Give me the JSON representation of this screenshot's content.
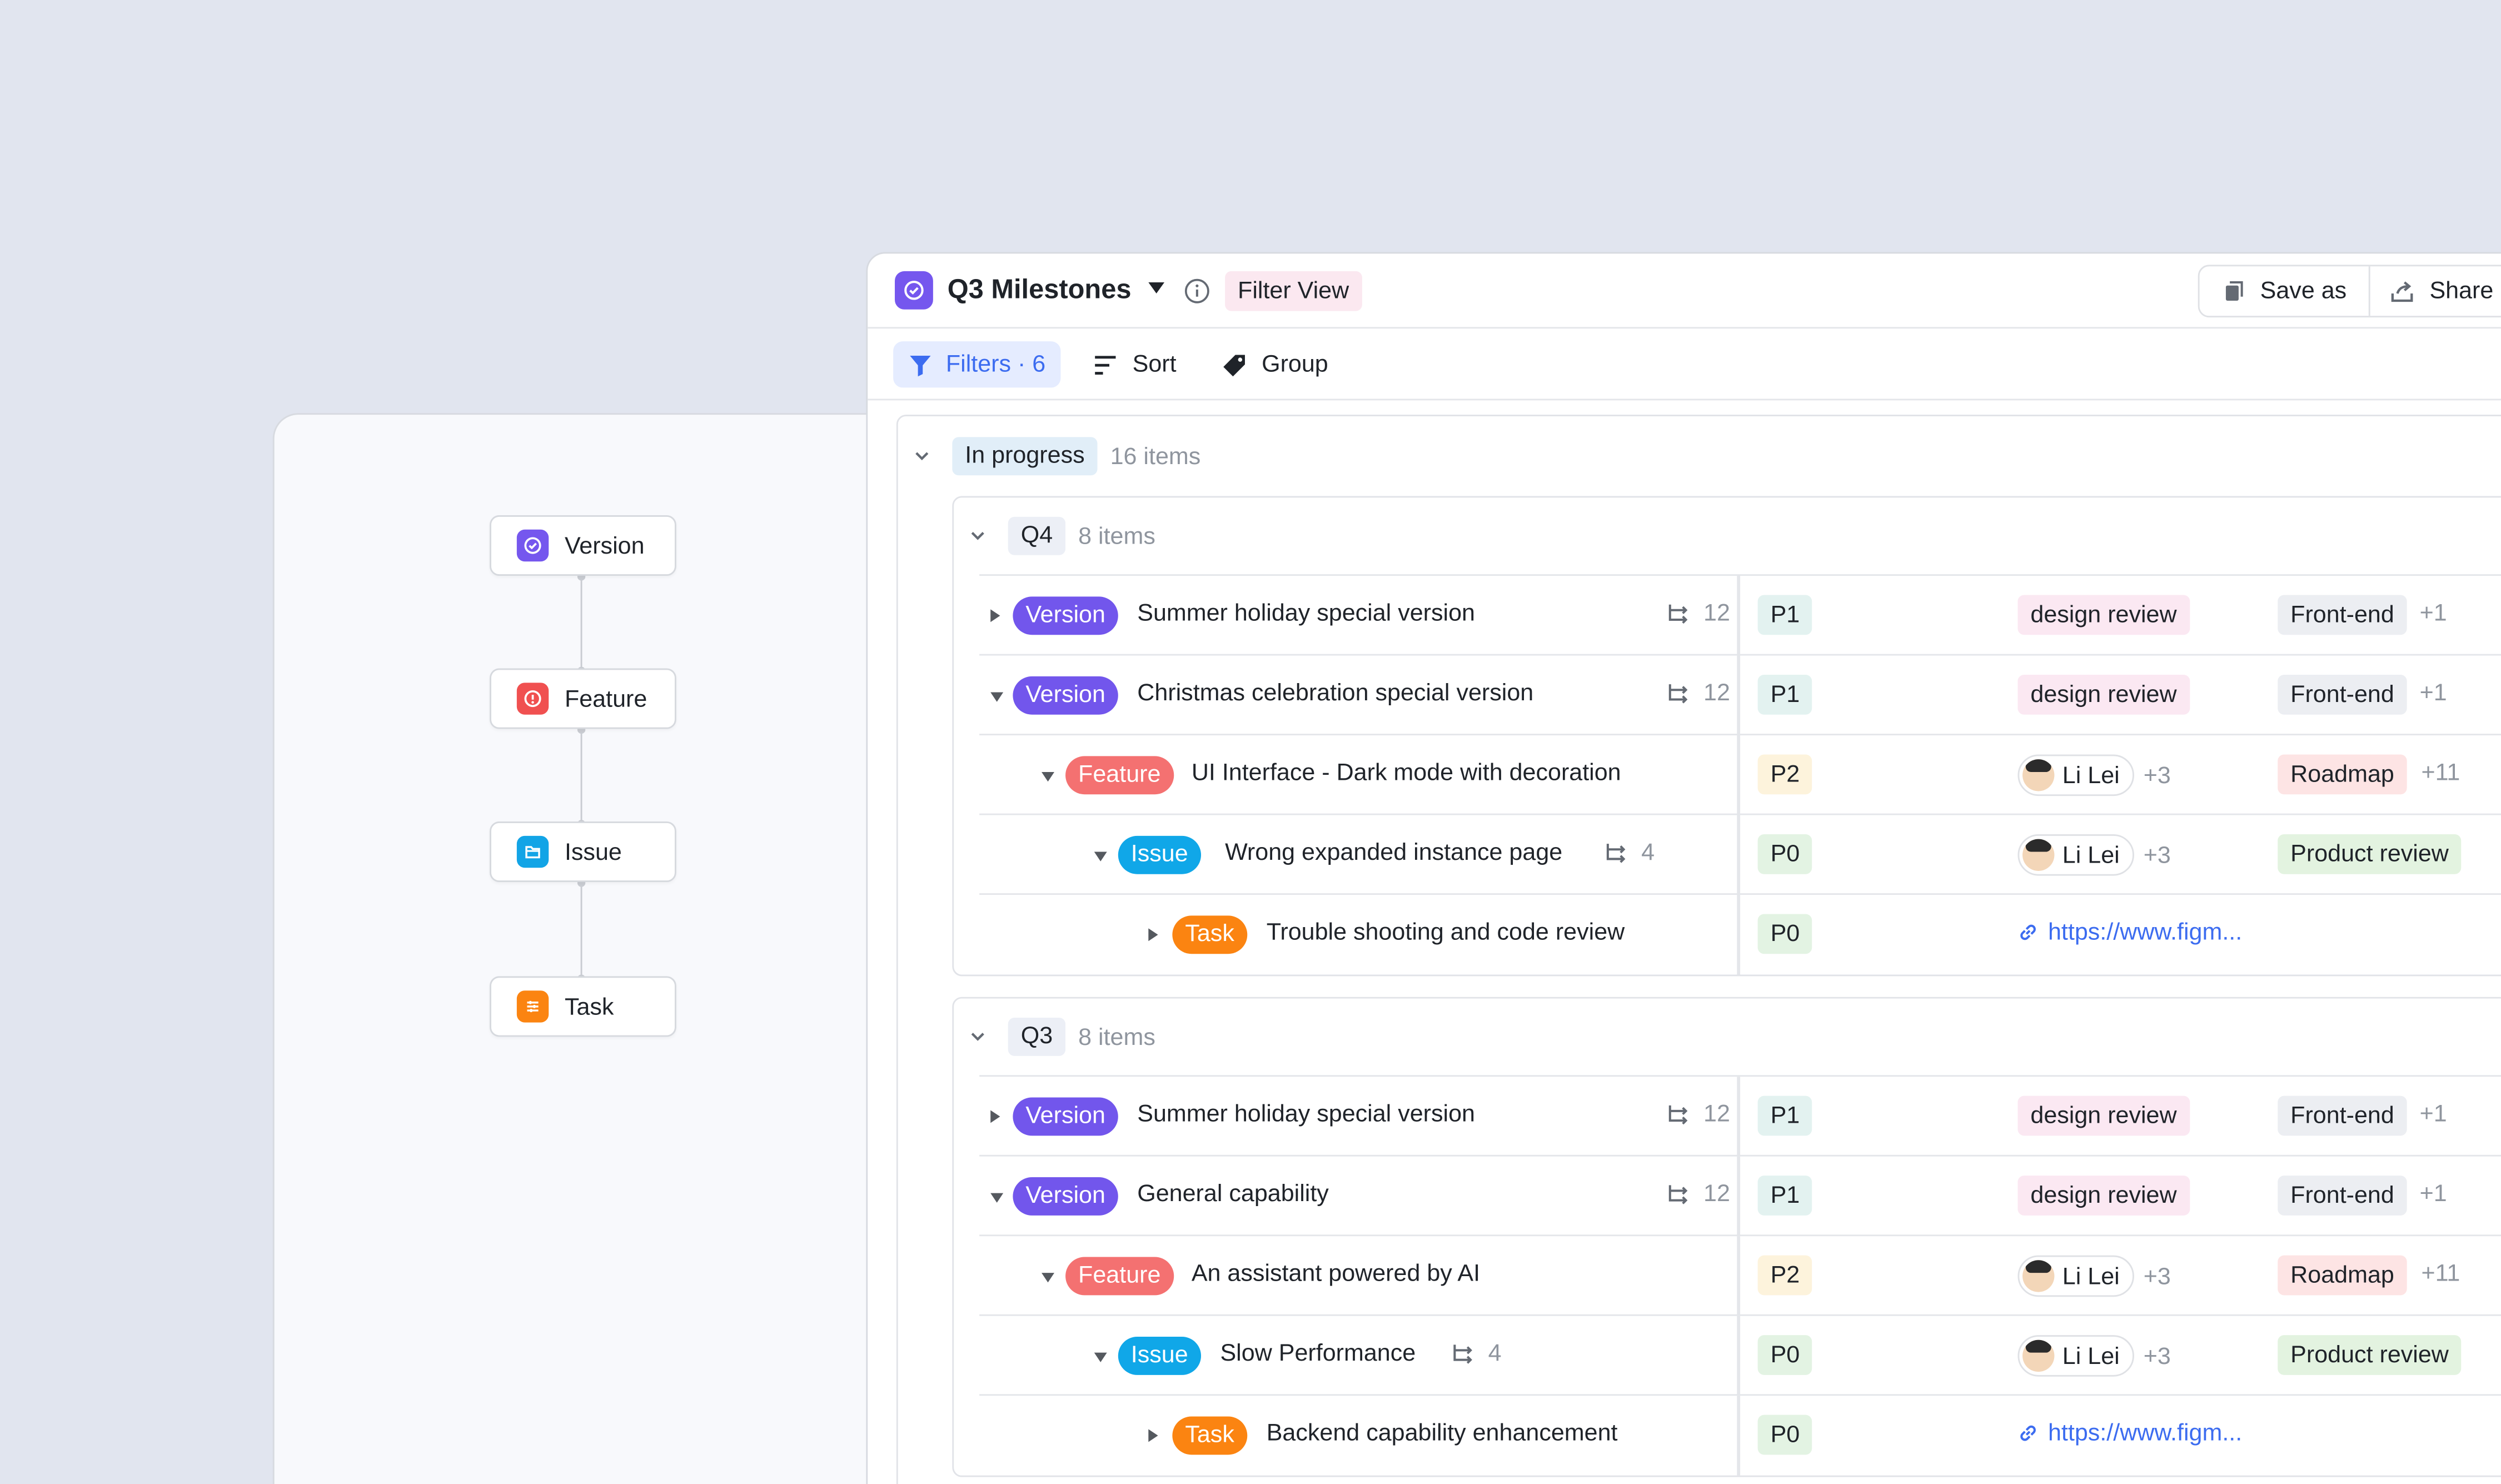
{
  "hierarchy": {
    "levels": [
      {
        "label": "Version",
        "color": "#7557ee",
        "icon": "check-circle-icon"
      },
      {
        "label": "Feature",
        "color": "#f05050",
        "icon": "alert-circle-icon"
      },
      {
        "label": "Issue",
        "color": "#12a4e6",
        "icon": "folder-icon"
      },
      {
        "label": "Task",
        "color": "#fb8411",
        "icon": "list-icon"
      }
    ]
  },
  "header": {
    "title": "Q3 Milestones",
    "view_tag": "Filter View",
    "save_as_label": "Save as",
    "share_label": "Share"
  },
  "toolbar": {
    "filters_label": "Filters · 6",
    "sort_label": "Sort",
    "group_label": "Group"
  },
  "group": {
    "label": "In progress",
    "count": "16 items",
    "subgroups": [
      {
        "label": "Q4",
        "count": "8 items",
        "rows": [
          {
            "type": "Version",
            "name": "Summer holiday special version",
            "subitems": "12",
            "priority": "P1",
            "col3": "design review",
            "col4": "Front-end",
            "col4_more": "+1"
          },
          {
            "type": "Version",
            "name": "Christmas celebration special version",
            "subitems": "12",
            "priority": "P1",
            "col3": "design review",
            "col4": "Front-end",
            "col4_more": "+1"
          },
          {
            "type": "Feature",
            "name": "UI Interface - Dark mode with decoration",
            "priority": "P2",
            "person": "Li Lei",
            "person_more": "+3",
            "col4": "Roadmap",
            "col4_more": "+11"
          },
          {
            "type": "Issue",
            "name": "Wrong expanded instance page",
            "subitems": "4",
            "priority": "P0",
            "person": "Li Lei",
            "person_more": "+3",
            "col4": "Product review"
          },
          {
            "type": "Task",
            "name": "Trouble shooting and code review",
            "priority": "P0",
            "link": "https://www.figm..."
          }
        ]
      },
      {
        "label": "Q3",
        "count": "8 items",
        "rows": [
          {
            "type": "Version",
            "name": "Summer holiday special version",
            "subitems": "12",
            "priority": "P1",
            "col3": "design review",
            "col4": "Front-end",
            "col4_more": "+1"
          },
          {
            "type": "Version",
            "name": "General capability",
            "subitems": "12",
            "priority": "P1",
            "col3": "design review",
            "col4": "Front-end",
            "col4_more": "+1"
          },
          {
            "type": "Feature",
            "name": "An assistant powered by AI",
            "priority": "P2",
            "person": "Li Lei",
            "person_more": "+3",
            "col4": "Roadmap",
            "col4_more": "+11"
          },
          {
            "type": "Issue",
            "name": "Slow Performance",
            "subitems": "4",
            "priority": "P0",
            "person": "Li Lei",
            "person_more": "+3",
            "col4": "Product review"
          },
          {
            "type": "Task",
            "name": "Backend capability enhancement",
            "priority": "P0",
            "link": "https://www.figm..."
          }
        ]
      }
    ]
  },
  "colors": {
    "version": "#7256ec",
    "feature": "#f47171",
    "issue": "#10a7e8",
    "task": "#fb8411",
    "accent": "#3c6cf0"
  }
}
